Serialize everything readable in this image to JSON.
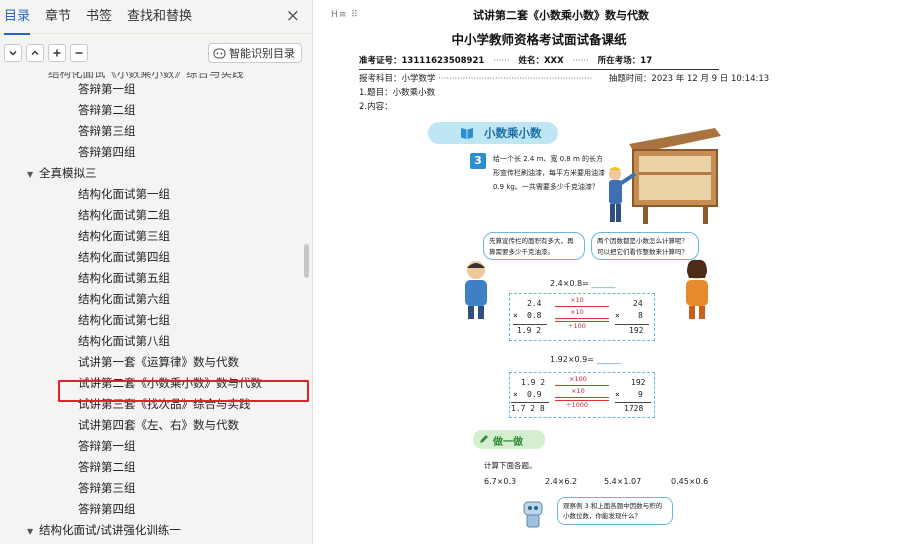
{
  "nav": {
    "tabs": [
      {
        "label": "目录",
        "active": true
      },
      {
        "label": "章节"
      },
      {
        "label": "书签"
      },
      {
        "label": "查找和替换"
      }
    ],
    "close_label": "×",
    "smart_button_label": "智能识别目录",
    "cut_item": "结构化面试《小数乘小数》综合与实践",
    "tree": [
      {
        "label": "答辩第一组",
        "level": 2
      },
      {
        "label": "答辩第二组",
        "level": 2
      },
      {
        "label": "答辩第三组",
        "level": 2
      },
      {
        "label": "答辩第四组",
        "level": 2
      },
      {
        "label": "全真模拟三",
        "level": 1,
        "caret": "▼"
      },
      {
        "label": "结构化面试第一组",
        "level": 2
      },
      {
        "label": "结构化面试第二组",
        "level": 2
      },
      {
        "label": "结构化面试第三组",
        "level": 2
      },
      {
        "label": "结构化面试第四组",
        "level": 2
      },
      {
        "label": "结构化面试第五组",
        "level": 2
      },
      {
        "label": "结构化面试第六组",
        "level": 2
      },
      {
        "label": "结构化面试第七组",
        "level": 2
      },
      {
        "label": "结构化面试第八组",
        "level": 2
      },
      {
        "label": "试讲第一套《运算律》数与代数",
        "level": 2
      },
      {
        "label": "试讲第二套《小数乘小数》数与代数",
        "level": 2,
        "selected": true
      },
      {
        "label": "试讲第三套《找次品》综合与实践",
        "level": 2
      },
      {
        "label": "试讲第四套《左、右》数与代数",
        "level": 2
      },
      {
        "label": "答辩第一组",
        "level": 2
      },
      {
        "label": "答辩第二组",
        "level": 2
      },
      {
        "label": "答辩第三组",
        "level": 2
      },
      {
        "label": "答辩第四组",
        "level": 2
      },
      {
        "label": "结构化面试/试讲强化训练一",
        "level": 1,
        "caret": "▼"
      }
    ]
  },
  "doc": {
    "heading": "试讲第二套《小数乘小数》数与代数",
    "subtitle": "中小学教师资格考试面试备课纸",
    "admission_no": "准考证号：13111623508921",
    "name": "姓名：XXX",
    "venue": "所在考场：17",
    "subject": "报考科目：小学数学",
    "draw_time": "抽题时间：2023 年 12 月 9 日 10:14:13",
    "topic": "1.题目：小数乘小数",
    "content": "2.内容：",
    "lesson_title": "小数乘小数",
    "problem_number": "3",
    "problem_text": "给一个长 2.4 m、宽 0.8 m 的长方形宣传栏刷油漆，每平方米要用油漆 0.9 kg。一共需要多少千克油漆？",
    "bubble_left": "先算宣传栏的面积有多大，再算需要多少千克油漆。",
    "bubble_right": "两个因数都是小数怎么计算呢？可以把它们看作整数来计算吗？",
    "calc1": {
      "expression": "2.4×0.8=",
      "factor_a": "2.4",
      "factor_b": "0.8",
      "product": "1.9 2",
      "int_a": "24",
      "int_b": "8",
      "int_product": "192",
      "times": "×",
      "arrow_a": "×10",
      "arrow_b": "×10",
      "arrow_c": "÷100"
    },
    "calc2": {
      "expression": "1.92×0.9=",
      "factor_a": "1.9 2",
      "factor_b": "0.9",
      "product": "1.7 2 8",
      "int_a": "192",
      "int_b": "9",
      "int_product": "1728",
      "times": "×",
      "arrow_a": "×100",
      "arrow_b": "×10",
      "arrow_c": "÷1000"
    },
    "practice_label": "做一做",
    "exercise_title": "计算下面各题。",
    "exercises": [
      "6.7×0.3",
      "2.4×6.2",
      "5.4×1.07",
      "0.45×0.6"
    ],
    "robot_text": "观察例 3 和上面各题中因数与积的小数位数，你能发现什么？"
  },
  "colors": {
    "accent": "#2a63c7",
    "highlight_box": "#e0232a",
    "banner": "#bfe6f3",
    "practice_banner": "#d4eecf"
  }
}
